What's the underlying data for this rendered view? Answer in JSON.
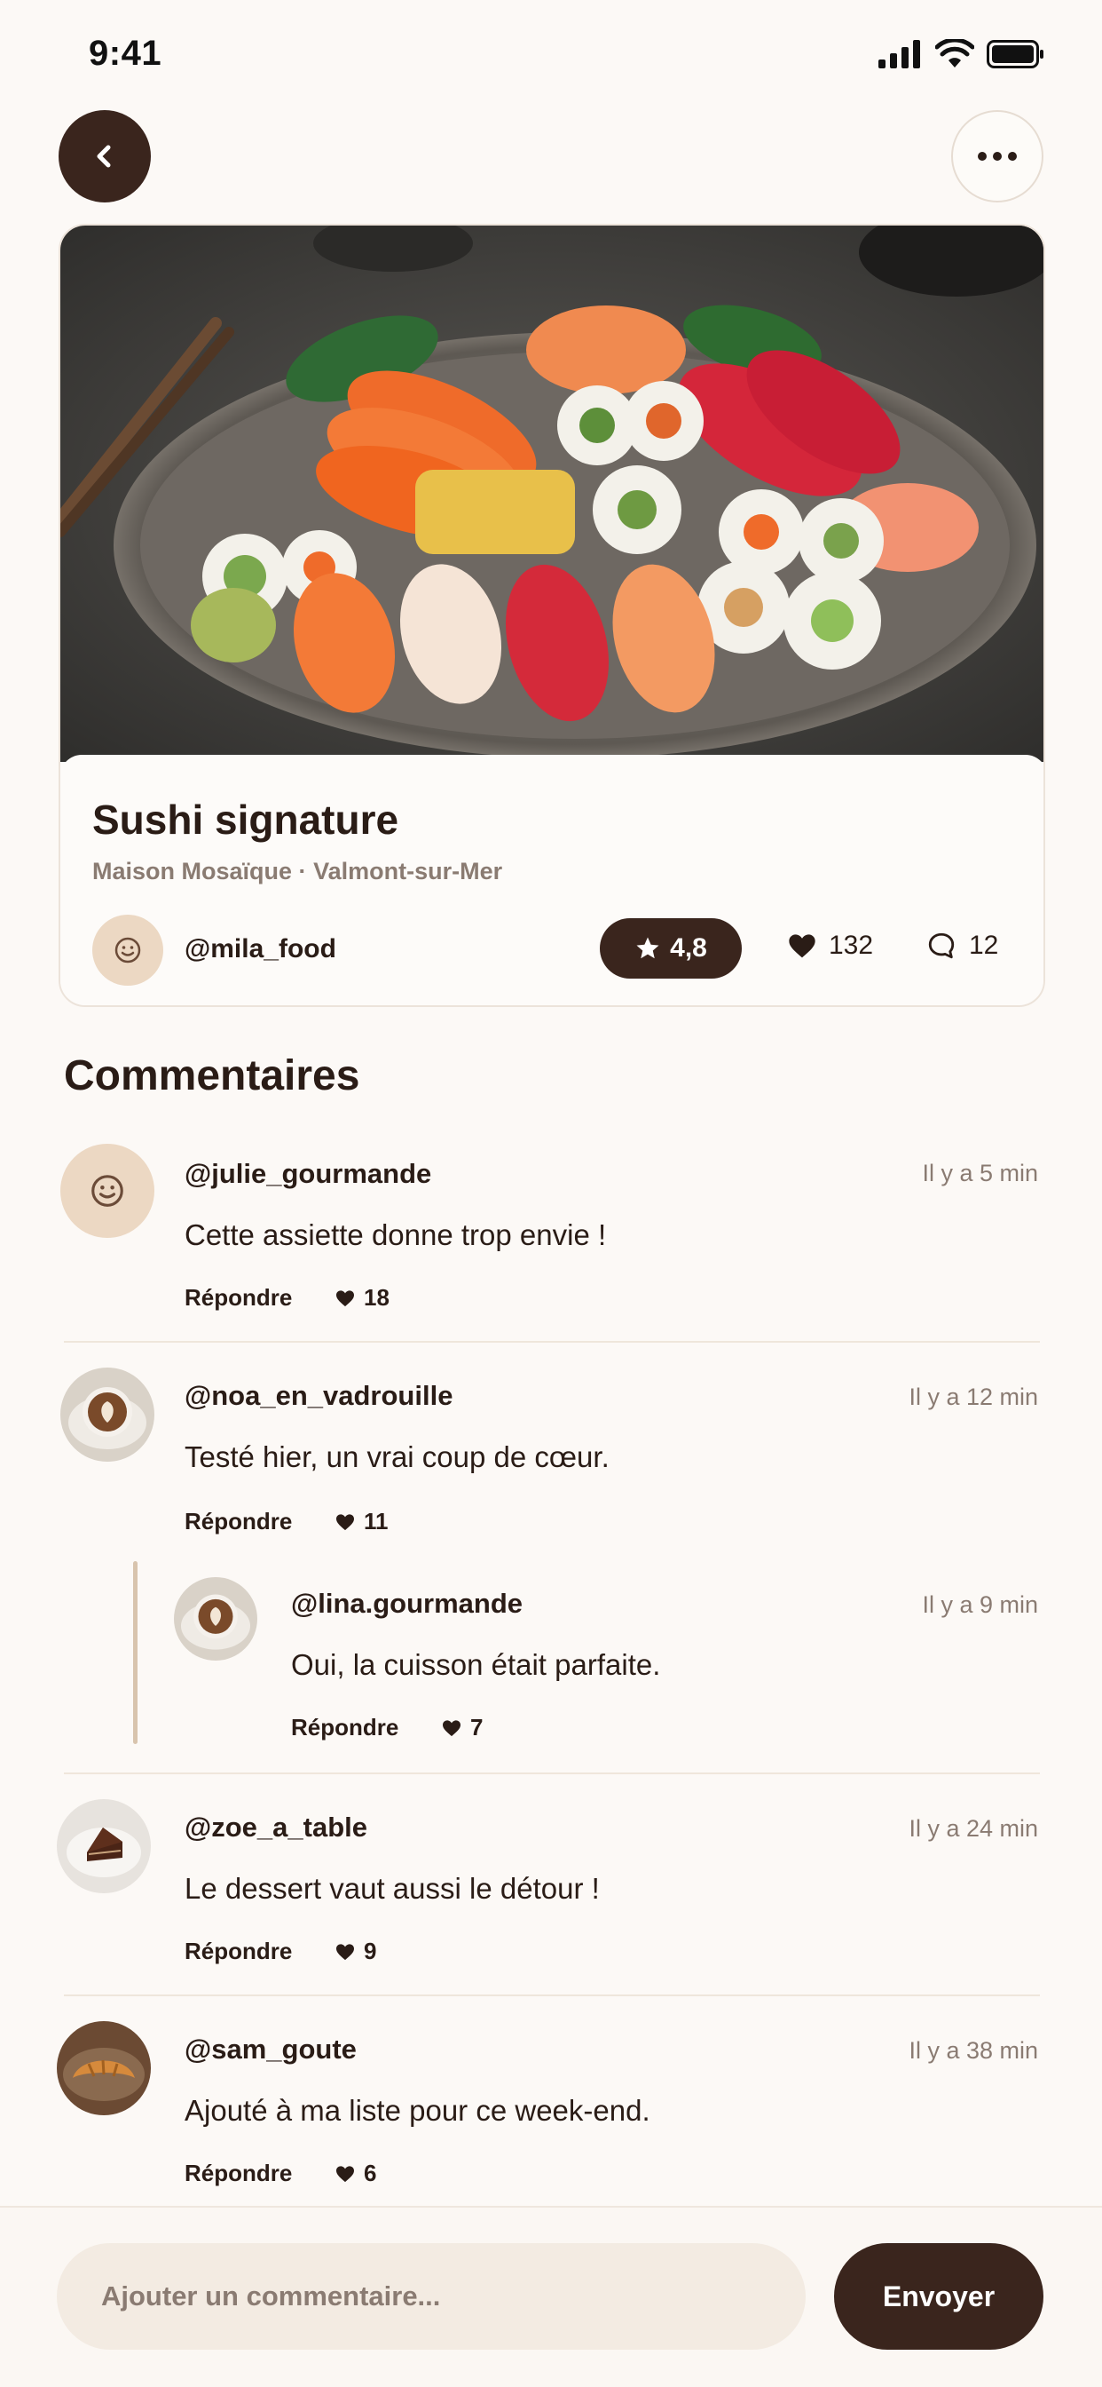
{
  "status_bar": {
    "time": "9:41"
  },
  "nav": {
    "back_icon": "chevron-left-icon",
    "more_icon": "ellipsis-icon"
  },
  "post": {
    "title": "Sushi signature",
    "restaurant": "Maison Mosaïque",
    "separator": "·",
    "city": "Valmont-sur-Mer",
    "author": "@mila_food",
    "rating": "4,8",
    "likes": "132",
    "comments": "12"
  },
  "comments_section": {
    "title": "Commentaires",
    "reply_label": "Répondre",
    "items": [
      {
        "user": "@julie_gourmande",
        "time": "Il y a 5 min",
        "text": "Cette assiette donne trop envie !",
        "likes": "18"
      },
      {
        "user": "@noa_en_vadrouille",
        "time": "Il y a 12 min",
        "text": "Testé hier, un vrai coup de cœur.",
        "likes": "11"
      },
      {
        "user": "@lina.gourmande",
        "time": "Il y a 9 min",
        "text": "Oui, la cuisson était parfaite.",
        "likes": "7"
      },
      {
        "user": "@zoe_a_table",
        "time": "Il y a 24 min",
        "text": "Le dessert vaut aussi le détour !",
        "likes": "9"
      },
      {
        "user": "@sam_goute",
        "time": "Il y a 38 min",
        "text": "Ajouté à ma liste pour ce week-end.",
        "likes": "6"
      }
    ]
  },
  "composer": {
    "placeholder": "Ajouter un commentaire...",
    "send_label": "Envoyer"
  },
  "colors": {
    "accent": "#3a251d",
    "background": "#fcf9f6",
    "muted": "#8a7b72"
  }
}
